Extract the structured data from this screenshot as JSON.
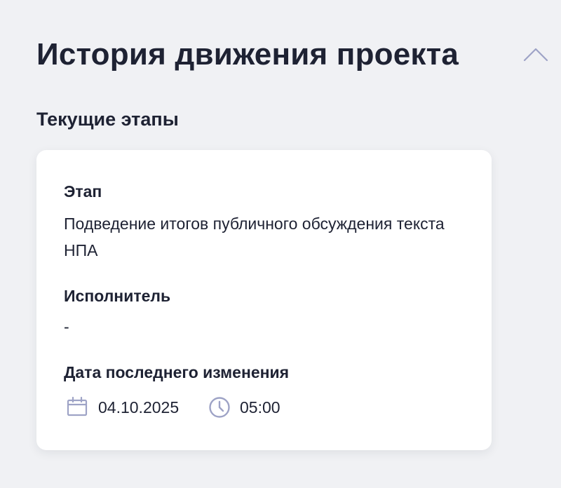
{
  "section": {
    "title": "История движения проекта",
    "collapse_icon": "chevron-up-icon",
    "subtitle": "Текущие этапы"
  },
  "stage_card": {
    "stage_label": "Этап",
    "stage_value": "Подведение итогов публичного обсуждения текста НПА",
    "executor_label": "Исполнитель",
    "executor_value": "-",
    "date_label": "Дата последнего изменения",
    "date_value": "04.10.2025",
    "date_icon": "calendar-icon",
    "time_value": "05:00",
    "time_icon": "clock-icon"
  },
  "colors": {
    "background": "#f0f1f4",
    "card": "#ffffff",
    "text": "#1e2233",
    "icon": "#9ea3c6"
  }
}
